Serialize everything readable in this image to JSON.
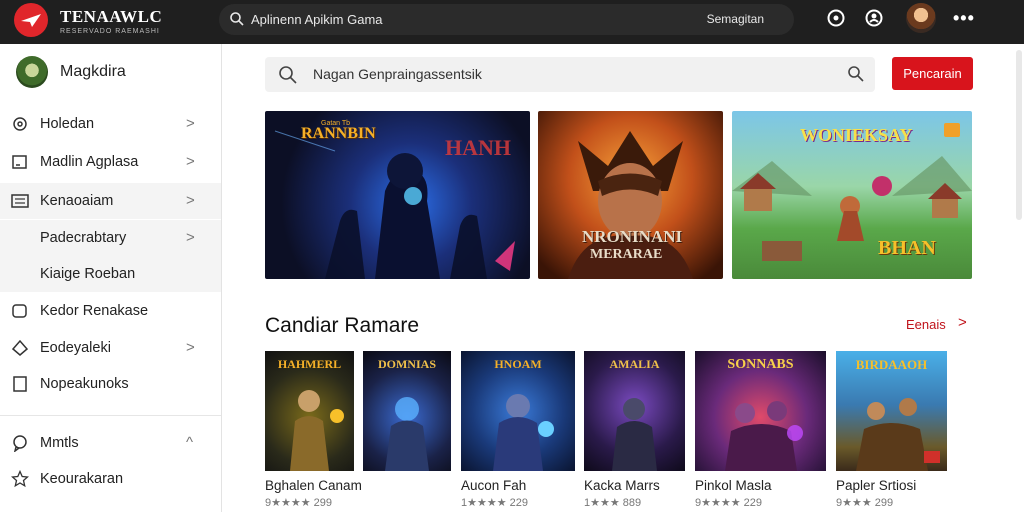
{
  "topbar": {
    "brand_name": "TENAAWLC",
    "brand_tagline": "RESERVADO RAEMASHI",
    "search_text": "Aplinenn Apikim Gama",
    "search_right": "Semagitan"
  },
  "sidebar": {
    "profile_name": "Magkdira",
    "items": [
      {
        "label": "Holedan",
        "icon": "gear-icon",
        "chevron": ">"
      },
      {
        "label": "Madlin Agplasa",
        "icon": "square-icon",
        "chevron": ">"
      },
      {
        "label": "Kenaoaiam",
        "icon": "list-icon",
        "chevron": ">"
      },
      {
        "label": "Padecrabtary",
        "icon": "",
        "chevron": ">"
      },
      {
        "label": "Kiaige Roeban",
        "icon": "",
        "chevron": ""
      },
      {
        "label": "Kedor Renakase",
        "icon": "tag-icon",
        "chevron": ""
      },
      {
        "label": "Eodeyaleki",
        "icon": "feather-icon",
        "chevron": ">"
      },
      {
        "label": "Nopeakunoks",
        "icon": "checkbox-icon",
        "chevron": ""
      },
      {
        "label": "Mmtls",
        "icon": "chat-icon",
        "chevron": "^"
      },
      {
        "label": "Keourakaran",
        "icon": "star-icon",
        "chevron": ""
      }
    ]
  },
  "main": {
    "search_placeholder": "Nagan Genpraingassentsik",
    "search_button": "Pencarain",
    "banners": [
      {
        "title": "RANNBIN",
        "subtitle": "Gatan Tb",
        "side": "HANH"
      },
      {
        "title": "NRONINANI",
        "subtitle": "MERARAE"
      },
      {
        "title": "WONIEKSAY",
        "subtitle": "BHAN"
      }
    ],
    "section_title": "Candiar Ramare",
    "see_all": "Eenais",
    "see_all_chev": ">",
    "cards": [
      {
        "title": "Bghalen Canam",
        "rating": "9★★★★ 299",
        "logo": "HAHMERL"
      },
      {
        "title": "Aucon Fah",
        "rating": "1★★★★ 229",
        "logo": "HNOAM"
      },
      {
        "title": "Kacka Marrs",
        "rating": "1★★★ 889",
        "logo": "AMALIA"
      },
      {
        "title": "Pinkol Masla",
        "rating": "9★★★★ 229",
        "logo": "SONNABS"
      },
      {
        "title": "Papler Srtiosi",
        "rating": "9★★★ 299",
        "logo": "BIRDAAOH"
      }
    ],
    "banner_card_logo": "DOMNIAS"
  },
  "colors": {
    "accent": "#d8141c",
    "topbar": "#1f1f1f"
  }
}
